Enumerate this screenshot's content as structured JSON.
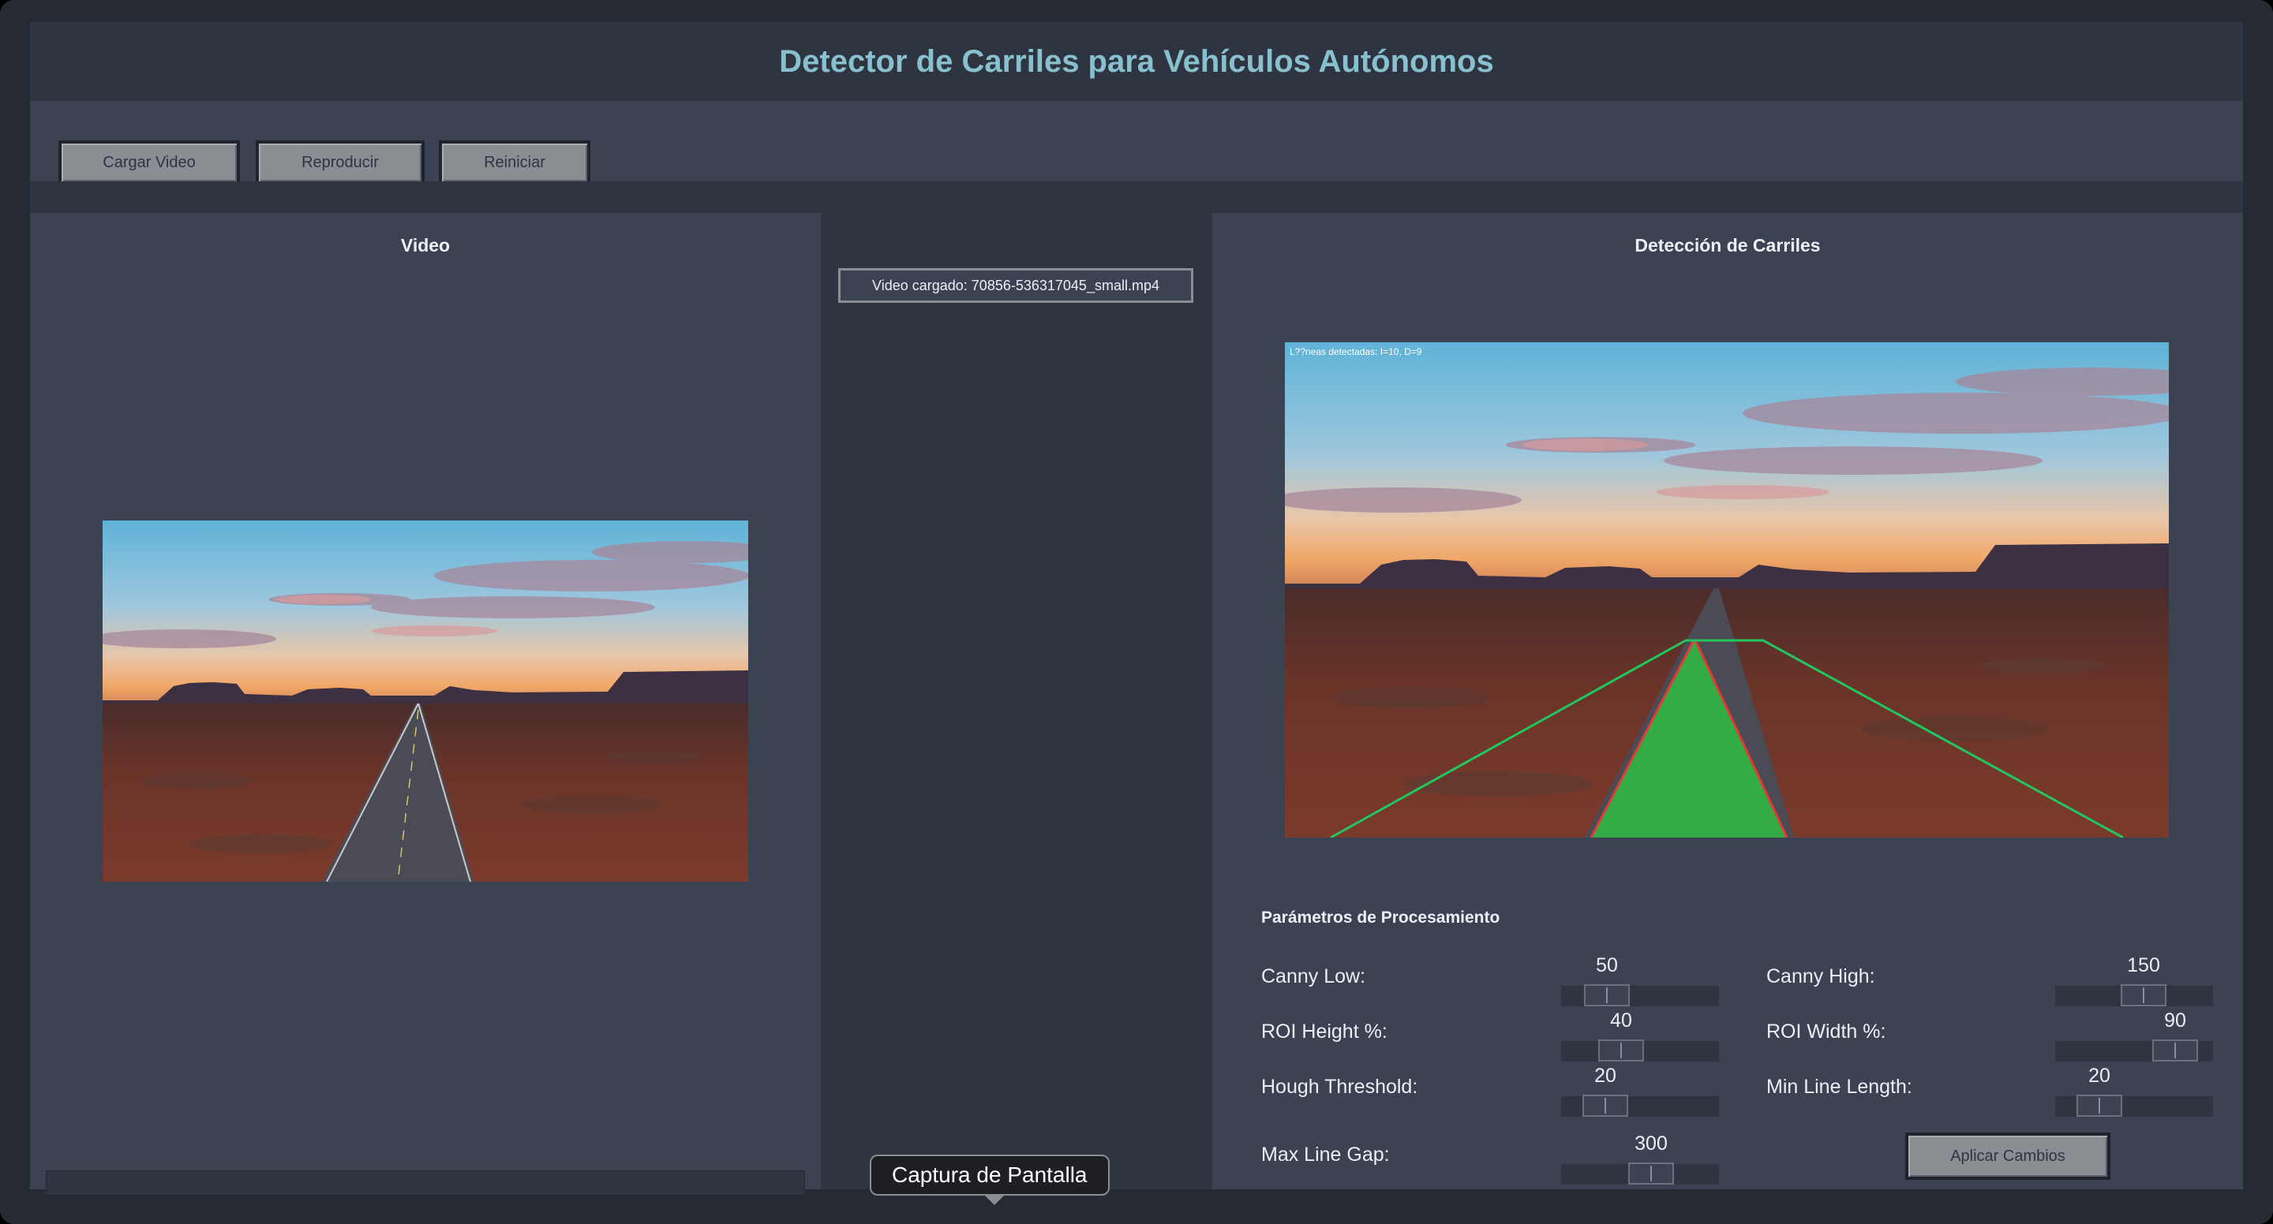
{
  "app": {
    "title": "Detector de Carriles para Vehículos Autónomos"
  },
  "toolbar": {
    "load_label": "Cargar Video",
    "play_label": "Reproducir",
    "reset_label": "Reiniciar"
  },
  "video_panel": {
    "title": "Video",
    "progress_fraction": 0.0
  },
  "status": {
    "text": "Video cargado: 70856-536317045_small.mp4"
  },
  "detection_panel": {
    "title": "Detección de Carriles",
    "overlay_text": "L??neas detectadas: I=10, D=9",
    "lane_color": "#22c55e",
    "lane_fill": "#2ecc40",
    "lane_edge_color": "#e53935"
  },
  "params": {
    "title": "Parámetros de Procesamiento",
    "canny_low": {
      "label": "Canny Low:",
      "value": "50"
    },
    "canny_high": {
      "label": "Canny High:",
      "value": "150"
    },
    "roi_height": {
      "label": "ROI Height %:",
      "value": "40"
    },
    "roi_width": {
      "label": "ROI Width %:",
      "value": "90"
    },
    "hough_threshold": {
      "label": "Hough Threshold:",
      "value": "20"
    },
    "min_line_length": {
      "label": "Min Line Length:",
      "value": "20"
    },
    "max_line_gap": {
      "label": "Max Line Gap:",
      "value": "300"
    },
    "apply_label": "Aplicar Cambios"
  },
  "tooltip": {
    "text": "Captura de Pantalla"
  },
  "colors": {
    "accent": "#88c0d0",
    "background": "#2e3440",
    "panel": "#3b4252",
    "button": "#8a8d92"
  }
}
